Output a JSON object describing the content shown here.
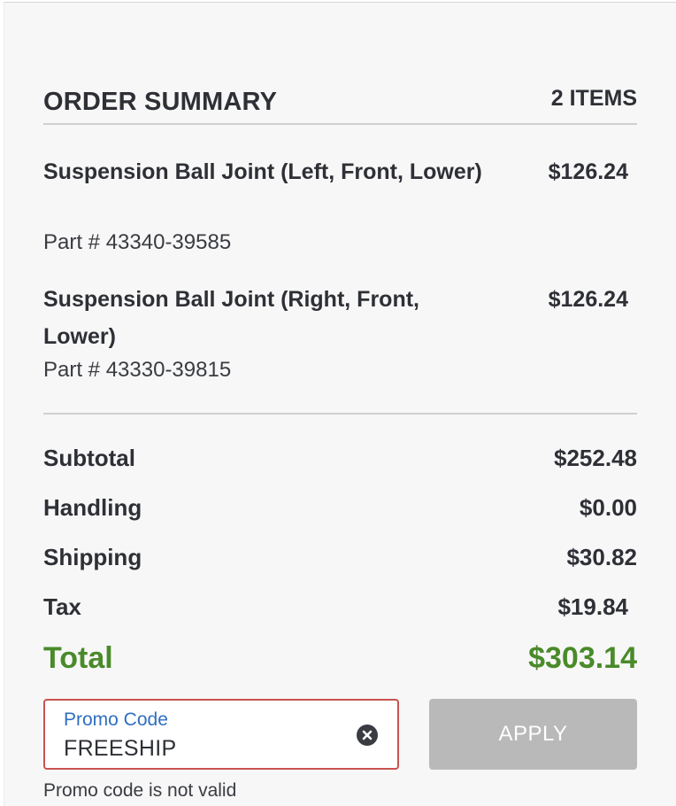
{
  "summary": {
    "title": "ORDER SUMMARY",
    "item_count": "2 ITEMS"
  },
  "items": [
    {
      "name": "Suspension Ball Joint (Left, Front, Lower)",
      "part": "Part # 43340-39585",
      "price": "$126.24"
    },
    {
      "name": "Suspension Ball Joint (Right, Front, Lower)",
      "part": "Part # 43330-39815",
      "price": "$126.24"
    }
  ],
  "totals": {
    "subtotal_label": "Subtotal",
    "subtotal_value": "$252.48",
    "handling_label": "Handling",
    "handling_value": "$0.00",
    "shipping_label": "Shipping",
    "shipping_value": "$30.82",
    "tax_label": "Tax",
    "tax_value": "$19.84",
    "total_label": "Total",
    "total_value": "$303.14"
  },
  "promo": {
    "label": "Promo Code",
    "value": "FREESHIP",
    "apply_label": "APPLY",
    "error": "Promo code is not valid",
    "clear_icon": "close-circle-icon"
  },
  "colors": {
    "total": "#4a8a2a",
    "promo_label": "#2f6fc0",
    "error_border": "#c9534f",
    "apply_disabled": "#b9b9b9"
  }
}
